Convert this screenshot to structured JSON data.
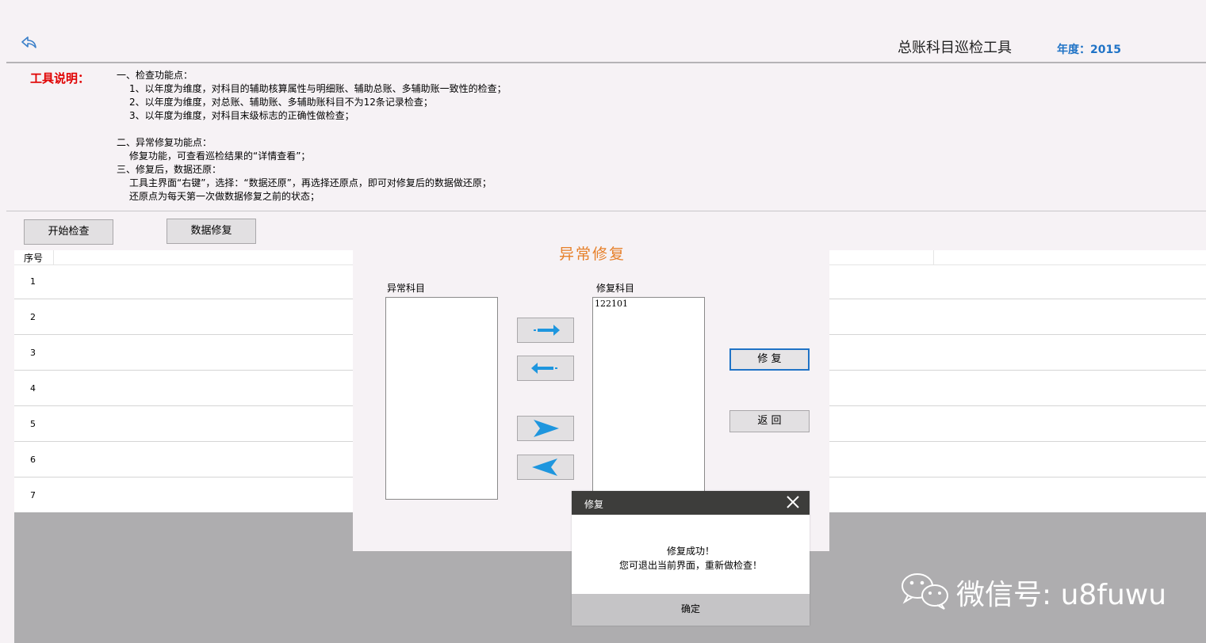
{
  "header": {
    "title": "总账科目巡检工具",
    "year_label": "年度：2015"
  },
  "description": {
    "label": "工具说明：",
    "lines": [
      "一、检查功能点：",
      "1、以年度为维度，对科目的辅助核算属性与明细账、辅助总账、多辅助账一致性的检查；",
      "2、以年度为维度，对总账、辅助账、多辅助账科目不为12条记录检查；",
      "3、以年度为维度，对科目末级标志的正确性做检查；",
      "二、异常修复功能点：",
      "修复功能，可查看巡检结果的“详情查看”；",
      "三、修复后，数据还原：",
      "工具主界面“右键”，选择：“数据还原”，再选择还原点，即可对修复后的数据做还原；",
      "还原点为每天第一次做数据修复之前的状态；"
    ]
  },
  "toolbar": {
    "start_check": "开始检查",
    "data_repair": "数据修复"
  },
  "grid": {
    "header_seq": "序号",
    "rows": [
      "1",
      "2",
      "3",
      "4",
      "5",
      "6",
      "7"
    ]
  },
  "repair_panel": {
    "title": "异常修复",
    "abnormal_label": "异常科目",
    "repair_label": "修复科目",
    "abnormal_items": [],
    "repair_items": [
      "122101"
    ],
    "repair_button": "修 复",
    "back_button": "返 回"
  },
  "dialog": {
    "title": "修复",
    "message_line1": "修复成功！",
    "message_line2": "您可退出当前界面，重新做检查！",
    "ok_button": "确定"
  },
  "watermark": {
    "text": "微信号: u8fuwu"
  },
  "colors": {
    "accent_blue": "#1f73c6",
    "arrow_blue": "#1e96de",
    "label_red": "#e00000",
    "panel_title_orange": "#e6802a",
    "dialog_header": "#3d3d3b"
  }
}
